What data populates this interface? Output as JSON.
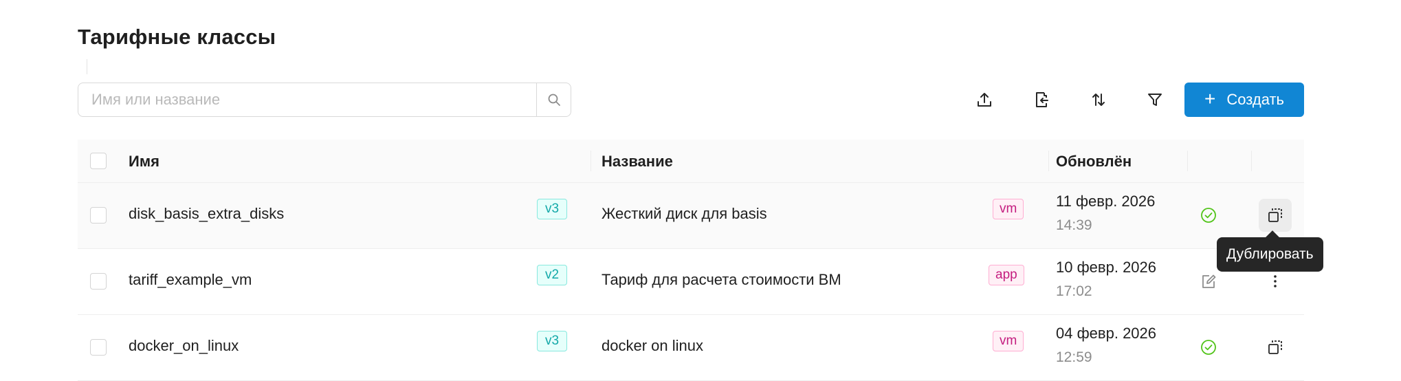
{
  "page": {
    "title": "Тарифные классы"
  },
  "search": {
    "placeholder": "Имя или название",
    "value": ""
  },
  "toolbar": {
    "upload_icon": "upload-icon",
    "import_icon": "file-import-icon",
    "sort_icon": "sort-icon",
    "filter_icon": "filter-icon",
    "create_label": "Создать",
    "create_plus": "+"
  },
  "table": {
    "headers": {
      "name": "Имя",
      "title": "Название",
      "updated": "Обновлён"
    },
    "rows": [
      {
        "name": "disk_basis_extra_disks",
        "version": "v3",
        "title": "Жесткий диск для basis",
        "type": "vm",
        "date": "11 февр. 2026",
        "time": "14:39",
        "status": "check-circle-icon",
        "action": "copy-icon"
      },
      {
        "name": "tariff_example_vm",
        "version": "v2",
        "title": "Тариф для расчета стоимости ВМ",
        "type": "app",
        "date": "10 февр. 2026",
        "time": "17:02",
        "status": "edit-icon",
        "action": "more-vertical-icon"
      },
      {
        "name": "docker_on_linux",
        "version": "v3",
        "title": "docker on linux",
        "type": "vm",
        "date": "04 февр. 2026",
        "time": "12:59",
        "status": "check-circle-icon",
        "action": "copy-icon"
      }
    ]
  },
  "tooltip": {
    "text": "Дублировать"
  },
  "colors": {
    "accent": "#1186d4",
    "success": "#52c41a",
    "version_badge": "#13a8a8",
    "type_badge": "#c41d7f",
    "tooltip_bg": "#262626"
  }
}
